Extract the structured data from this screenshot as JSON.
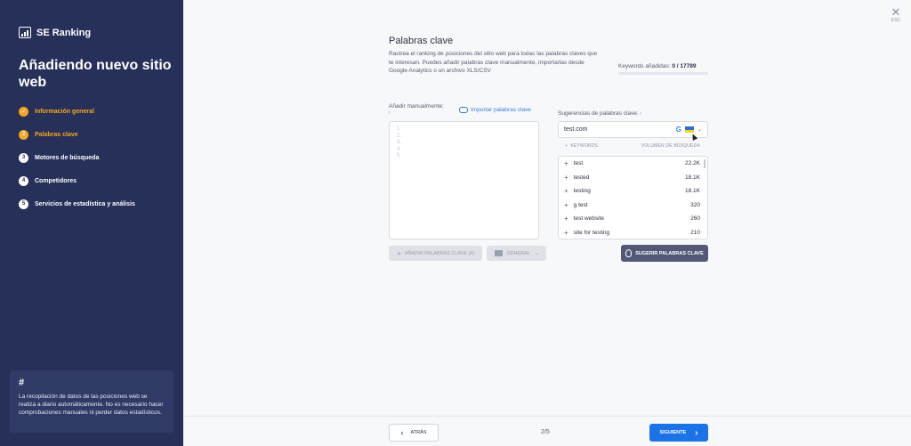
{
  "sidebar": {
    "logo_text": "SE Ranking",
    "title": "Añadiendo nuevo sitio web",
    "steps": [
      {
        "num": "✓",
        "label": "Información general",
        "state": "done"
      },
      {
        "num": "2",
        "label": "Palabras clave",
        "state": "active"
      },
      {
        "num": "3",
        "label": "Motores de búsqueda",
        "state": "pending"
      },
      {
        "num": "4",
        "label": "Competidores",
        "state": "pending"
      },
      {
        "num": "5",
        "label": "Servicios de estadística y análisis",
        "state": "pending"
      }
    ],
    "note_hash": "#",
    "note_text": "La recopilación de datos de las posiciones web se realiza a diario automáticamente. No es necesario hacer comprobaciones manuales ni perder datos estadísticos."
  },
  "close": {
    "icon": "close-icon",
    "label": "ESC"
  },
  "main": {
    "title": "Palabras clave",
    "description": "Rastrea el ranking de posiciones del sitio web para todas las palabras claves que te interesan. Puedes añadir palabras clave manualmente, importarlas desde Google Analytics o un archivo XLS/CSV",
    "counter_label": "Keywords añadidas:",
    "counter_value": "0 / 17789",
    "manual_label": "Añadir manualmente:",
    "manual_hint": "i",
    "import_label": "Importar palabras clave",
    "line_numbers": [
      "1.",
      "2.",
      "3.",
      "4.",
      "5."
    ],
    "add_button": "AÑADIR PALABRAS CLAVE (0)",
    "group_button": "GENERAL",
    "suggestions_label": "Sugerencias de palabras clave:",
    "suggestions_hint": "i",
    "domain_value": "test.com",
    "engine_letter": "G",
    "col_keywords": "KEYWORDS",
    "col_volume": "VOLUMEN DE BÚSQUEDA",
    "suggestions": [
      {
        "keyword": "test",
        "volume": "22.2K"
      },
      {
        "keyword": "tested",
        "volume": "18.1K"
      },
      {
        "keyword": "testing",
        "volume": "18.1K"
      },
      {
        "keyword": "g test",
        "volume": "320"
      },
      {
        "keyword": "test website",
        "volume": "260"
      },
      {
        "keyword": "site for testing",
        "volume": "210"
      }
    ],
    "suggest_button": "SUGERIR PALABRAS CLAVE"
  },
  "footer": {
    "back_label": "ATRÁS",
    "pager": "2/5",
    "next_label": "SIGUIENTE"
  },
  "colors": {
    "sidebar_bg": "#263059",
    "accent": "#f5a623",
    "primary": "#1a74e8",
    "flag_top": "#2f6fd0",
    "flag_bottom": "#f5d31a"
  }
}
